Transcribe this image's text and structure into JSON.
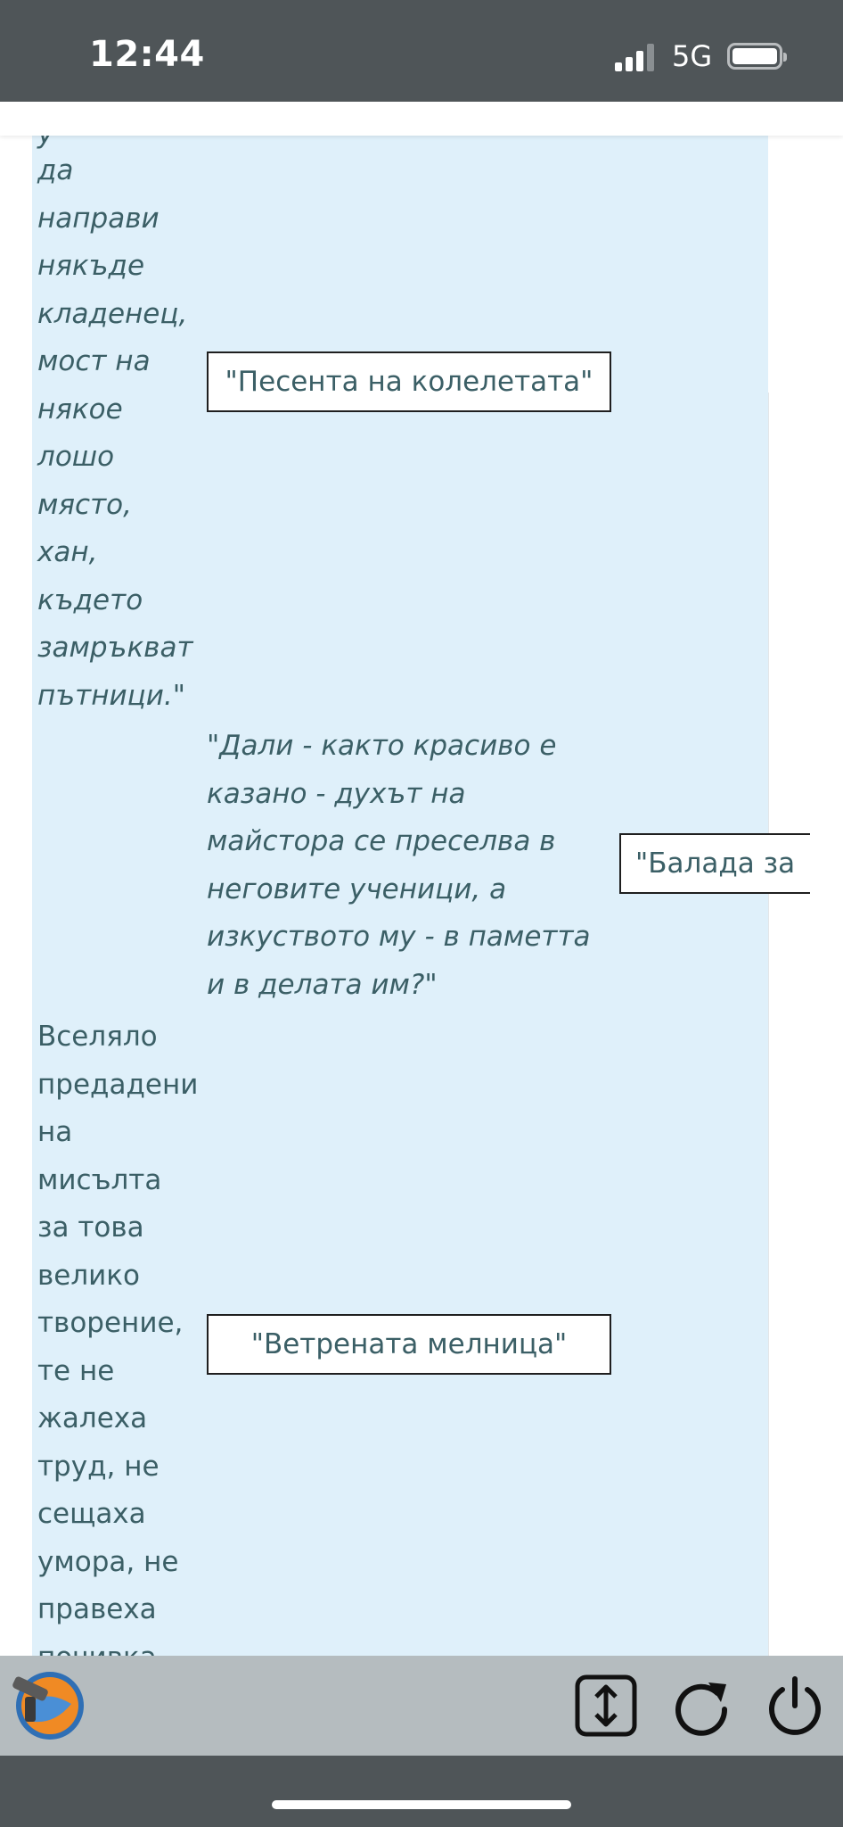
{
  "status_bar": {
    "time": "12:44",
    "network": "5G",
    "signal_bars_active": 3,
    "signal_bars_total": 4,
    "battery_level": 0.9
  },
  "content": {
    "partial_top_line": "у",
    "left_quote_1": "да\nнаправи\nнякъде\nкладенец,\nмост на\nнякое\nлошо\nмясто,\nхан,\nкъдето\nзамръкват\nпътници.\"",
    "middle_quote": "\"Дали - както красиво е\nказано - духът на\nмайстора се преселва в\nнеговите ученици, а\nизкуството му - в паметта\nи в делата им?\"",
    "left_text_2": "Вселяло\nпредадени\nна\nмисълта\nза това\nвелико\nтворение,\nте не\nжалеха\nтруд, не\nсещаха\nумора, не\nправеха\nпочивка,",
    "boxes": [
      {
        "label": "\"Песента на колелетата\""
      },
      {
        "label": "\"Балада за"
      },
      {
        "label": "\"Ветрената мелница\""
      }
    ]
  },
  "toolbar": {
    "app_icon": "app-logo-icon",
    "buttons": [
      {
        "name": "scroll-toggle-button",
        "icon": "up-down-arrows-icon"
      },
      {
        "name": "reload-button",
        "icon": "refresh-icon"
      },
      {
        "name": "power-button",
        "icon": "power-icon"
      }
    ]
  },
  "colors": {
    "panel_bg": "#dff0fa",
    "text": "#3b5f66",
    "status_bar_bg": "#4f5558",
    "toolbar_bg": "#b5bcbf"
  }
}
